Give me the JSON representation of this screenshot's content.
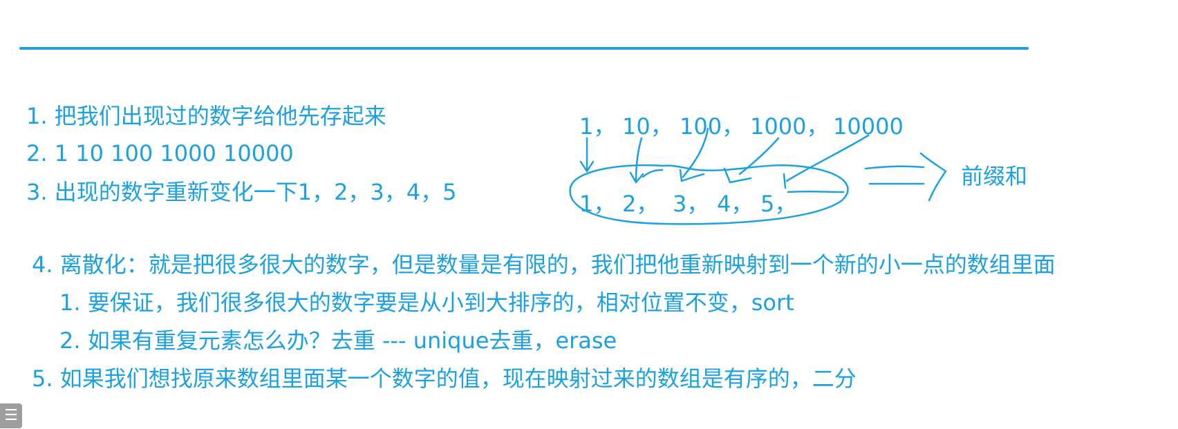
{
  "notes": {
    "line1": "1. 把我们出现过的数字给他先存起来",
    "line2": "2. 1 10 100 1000 10000",
    "line3": "3. 出现的数字重新变化一下1，2，3，4，5",
    "line4": "4. 离散化：就是把很多很大的数字，但是数量是有限的，我们把他重新映射到一个新的小一点的数组里面",
    "line4_1": "1. 要保证，我们很多很大的数字要是从小到大排序的，相对位置不变，sort",
    "line4_2": "2. 如果有重复元素怎么办？去重 --- unique去重，erase",
    "line5": "5. 如果我们想找原来数组里面某一个数字的值，现在映射过来的数组是有序的，二分"
  },
  "sketch": {
    "original": [
      "1，",
      "10，",
      "100，",
      "1000，",
      "10000"
    ],
    "mapped": [
      "1，",
      "2，",
      "3，",
      "4，",
      "5，"
    ],
    "result_label": "前缀和"
  },
  "toc_icon": "list-icon",
  "colors": {
    "ink": "#1ba1e2",
    "toc_bg": "#9e9e9e"
  }
}
